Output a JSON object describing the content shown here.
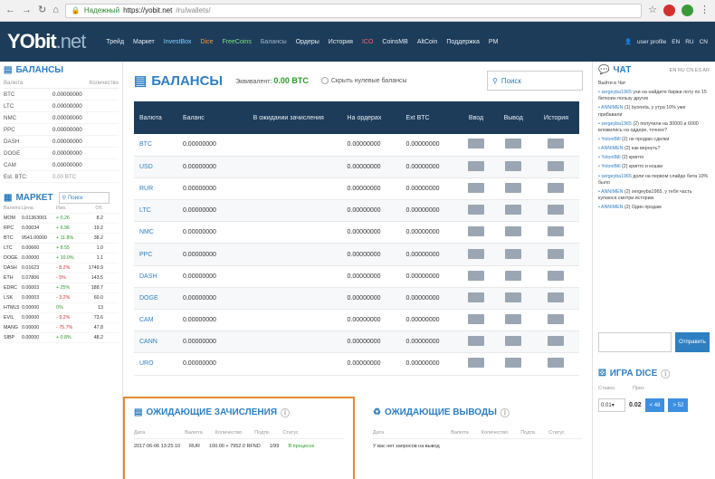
{
  "browser": {
    "secure_label": "Надежный",
    "url_host": "https://yobit.net",
    "url_path": "/ru/wallets/"
  },
  "logo": {
    "main": "YObit",
    "suffix": ".net"
  },
  "menu": [
    "Трейд",
    "Маркет",
    "InvestBox",
    "Dice",
    "FreeCoins",
    "Балансы",
    "Ордеры",
    "История",
    "ICO",
    "CoinsMB",
    "AltCoin",
    "Поддержка",
    "PM"
  ],
  "user": {
    "name": "user profile"
  },
  "langs": [
    "EN",
    "RU",
    "CN"
  ],
  "left": {
    "balances_title": "БАЛАНСЫ",
    "cols": [
      "Валюта",
      "Количество"
    ],
    "rows": [
      [
        "BTC",
        "0.00000000"
      ],
      [
        "LTC",
        "0.00000000"
      ],
      [
        "NMC",
        "0.00000000"
      ],
      [
        "PPC",
        "0.00000000"
      ],
      [
        "DASH",
        "0.00000000"
      ],
      [
        "DOGE",
        "0.00000000"
      ],
      [
        "CAM",
        "0.00000000"
      ]
    ],
    "total": [
      "Est. BTC:",
      "0.00 BTC"
    ],
    "market_title": "МАРКЕТ",
    "market_search": "Поиск",
    "market_cols": [
      "Валюта",
      "Цена",
      "Изм.",
      "Об."
    ],
    "market_rows": [
      [
        "MOM",
        "0.01363001",
        "+ 0.26",
        "8.2",
        "up"
      ],
      [
        "RPC",
        "0.00034",
        "+ 6.96",
        "19.2",
        "up"
      ],
      [
        "BTC",
        "9541.00000",
        "+ 11.8%",
        "38.2",
        "up"
      ],
      [
        "LTC",
        "0.00660",
        "+ 8.55",
        "1.0",
        "up"
      ],
      [
        "DOGE",
        "0.00000",
        "+ 10.0%",
        "1.1",
        "up"
      ],
      [
        "DASH",
        "0.01623",
        "- 8.2%",
        "1749.9",
        "dn"
      ],
      [
        "ETH",
        "0.07806",
        "- 5%",
        "143.5",
        "dn"
      ],
      [
        "EDRC",
        "0.00003",
        "+ 25%",
        "188.7",
        "up"
      ],
      [
        "LSK",
        "0.00003",
        "- 3.2%",
        "60.0",
        "dn"
      ],
      [
        "HTML5",
        "0.00000",
        "0%",
        "13",
        "up"
      ],
      [
        "EVIL",
        "0.00000",
        "- 9.2%",
        "73.6",
        "dn"
      ],
      [
        "MANG",
        "0.00000",
        "- 75.7%",
        "47.8",
        "dn"
      ],
      [
        "SIBP",
        "0.00000",
        "+ 0.8%",
        "48.2",
        "up"
      ]
    ]
  },
  "balances": {
    "title": "БАЛАНСЫ",
    "est_label": "Эквивалент:",
    "est_value": "0.00 BTC",
    "hide_zero": "Скрыть нулевые балансы",
    "search_placeholder": "Поиск",
    "cols": [
      "Валюта",
      "Баланс",
      "В ожидании зачисления",
      "На ордерах",
      "Ext BTC",
      "Ввод",
      "Вывод",
      "История"
    ],
    "rows": [
      [
        "BTC",
        "0.00000000",
        "",
        "0.00000000",
        "0.00000000"
      ],
      [
        "USD",
        "0.00000000",
        "",
        "0.00000000",
        "0.00000000"
      ],
      [
        "RUR",
        "0.00000000",
        "",
        "0.00000000",
        "0.00000000"
      ],
      [
        "LTC",
        "0.00000000",
        "",
        "0.00000000",
        "0.00000000"
      ],
      [
        "NMC",
        "0.00000000",
        "",
        "0.00000000",
        "0.00000000"
      ],
      [
        "PPC",
        "0.00000000",
        "",
        "0.00000000",
        "0.00000000"
      ],
      [
        "DASH",
        "0.00000000",
        "",
        "0.00000000",
        "0.00000000"
      ],
      [
        "DOGE",
        "0.00000000",
        "",
        "0.00000000",
        "0.00000000"
      ],
      [
        "CAM",
        "0.00000000",
        "",
        "0.00000000",
        "0.00000000"
      ],
      [
        "CANN",
        "0.00000000",
        "",
        "0.00000000",
        "0.00000000"
      ],
      [
        "URO",
        "0.00000000",
        "",
        "0.00000000",
        "0.00000000"
      ]
    ]
  },
  "pending_in": {
    "title": "ОЖИДАЮЩИЕ ЗАЧИСЛЕНИЯ",
    "cols": [
      "Дата",
      "Валюта",
      "Количество",
      "Подтв.",
      "Статус"
    ],
    "row": [
      "2017-06-06 13:25:10",
      "RUR",
      "100.00 + 7952.0 RFND",
      "1/99",
      "В процессе"
    ]
  },
  "pending_out": {
    "title": "ОЖИДАЮЩИЕ ВЫВОДЫ",
    "cols": [
      "Дата",
      "Валюта",
      "Количество",
      "Подтв.",
      "Статус"
    ],
    "empty": "У вас нет запросов на вывод"
  },
  "chat": {
    "title": "ЧАТ",
    "langs": "EN RU CN ES AR",
    "intro": "Выйти в Чат",
    "messages": [
      [
        "sergeyba1965",
        "ухи на найдите биржи лоту по 15 биткоин пользу других"
      ],
      [
        "ANNIMEN",
        "(1) byoneta, у утра 10% уже прибавили"
      ],
      [
        "sergeyba1965",
        "(2) получили на 30000 и 6000 вложились на оддере, точнее?"
      ],
      [
        "YoloniBill",
        "(2) не продаю сделки"
      ],
      [
        "ANNIMEN",
        "(2) как вернуть?"
      ],
      [
        "YoloniBill",
        "(2) крипто"
      ],
      [
        "YoloniBill",
        "(2) крипто и кошки"
      ],
      [
        "sergeyba1965",
        "доли на первом слайде бита 10% было"
      ],
      [
        "ANNIMEN",
        "(2) sergeyba1965, у тебя часть купаюся смотри историю"
      ],
      [
        "ANNIMEN",
        "(2) Один продам"
      ]
    ],
    "send": "Отправить"
  },
  "dice": {
    "title": "ИГРА DICE",
    "labels": [
      "Ставка",
      "Приз"
    ],
    "amount": "0.01",
    "prize": "0.02",
    "btn1": "< 48",
    "btn2": "> 52"
  }
}
